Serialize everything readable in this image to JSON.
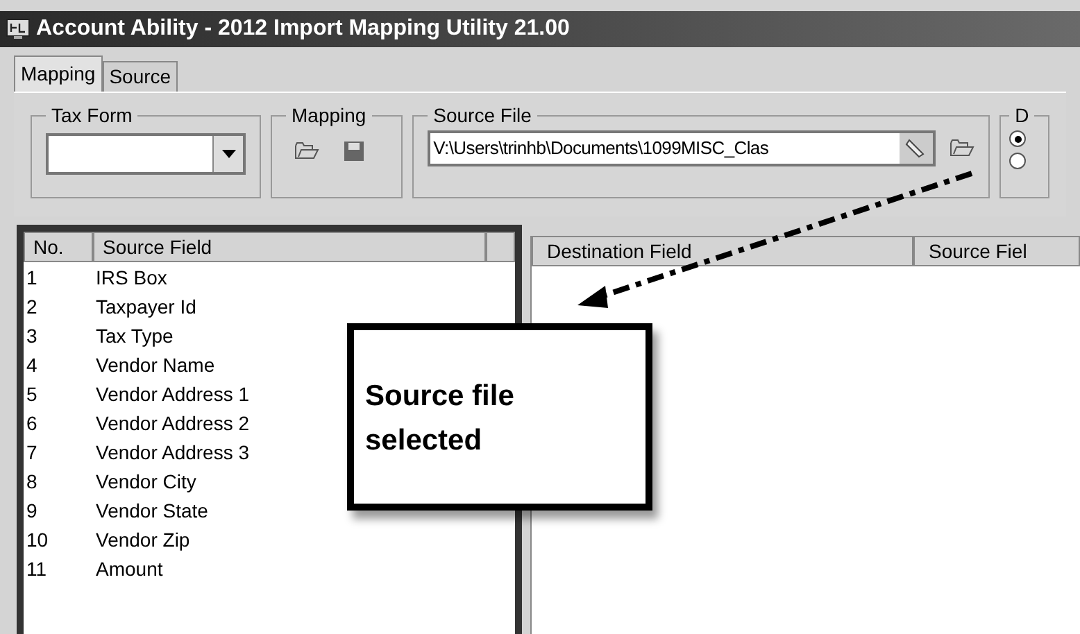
{
  "window": {
    "title": "Account Ability - 2012 Import Mapping Utility 21.00"
  },
  "tabs": [
    {
      "label": "Mapping",
      "selected": true
    },
    {
      "label": "Source",
      "selected": false
    }
  ],
  "tax_form": {
    "label": "Tax Form"
  },
  "mapping_group": {
    "label": "Mapping"
  },
  "source_file": {
    "label": "Source File",
    "value": "V:\\Users\\trinhb\\Documents\\1099MISC_Clas"
  },
  "group_4": {
    "label": "D",
    "radios": [
      {
        "selected": true
      },
      {
        "selected": false
      }
    ]
  },
  "source_list": {
    "columns": [
      "No.",
      "Source Field"
    ],
    "rows": [
      [
        "1",
        "IRS Box"
      ],
      [
        "2",
        "Taxpayer Id"
      ],
      [
        "3",
        "Tax Type"
      ],
      [
        "4",
        "Vendor Name"
      ],
      [
        "5",
        "Vendor Address 1"
      ],
      [
        "6",
        "Vendor Address 2"
      ],
      [
        "7",
        "Vendor Address 3"
      ],
      [
        "8",
        "Vendor City"
      ],
      [
        "9",
        "Vendor State"
      ],
      [
        "10",
        "Vendor Zip"
      ],
      [
        "11",
        "Amount"
      ]
    ]
  },
  "destination_list": {
    "columns": [
      "Destination Field",
      "Source Fiel"
    ]
  },
  "callout": {
    "text": "Source file selected"
  }
}
